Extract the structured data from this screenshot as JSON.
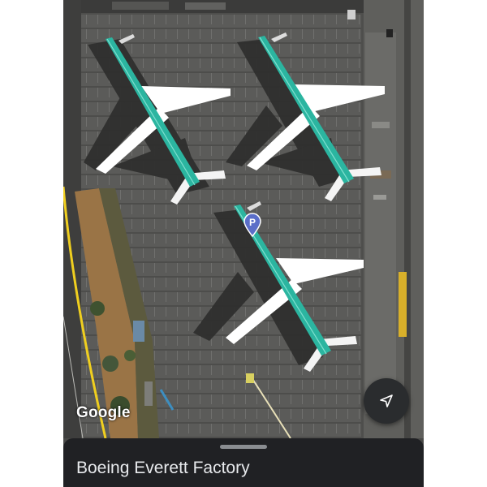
{
  "map": {
    "attribution": "Google",
    "poi_marker_letter": "P",
    "map_type": "satellite"
  },
  "controls": {
    "locate_icon": "navigation-arrow-icon"
  },
  "sheet": {
    "title": "Boeing Everett Factory"
  },
  "colors": {
    "aircraft_livery": "#2bb5a0",
    "sheet_background": "#202124",
    "pin": "#5b6ec8"
  }
}
